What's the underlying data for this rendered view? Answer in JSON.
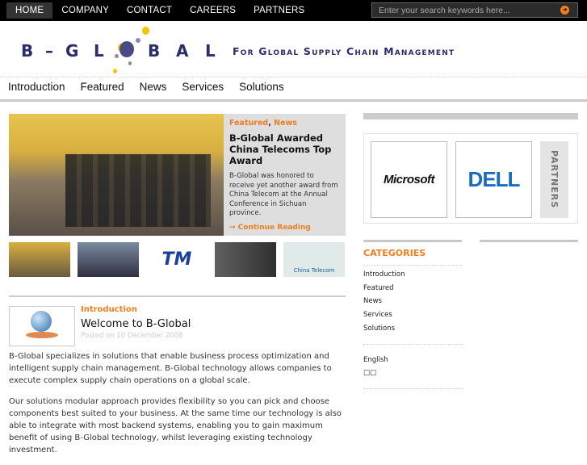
{
  "topnav": {
    "items": [
      "HOME",
      "COMPANY",
      "CONTACT",
      "CAREERS",
      "PARTNERS"
    ],
    "search_placeholder": "Enter your search keywords here..."
  },
  "logo": {
    "letters": [
      "B",
      "–",
      "G",
      "L",
      "B",
      "A",
      "L"
    ],
    "tagline": "For Global Supply Chain Management"
  },
  "mainnav": [
    "Introduction",
    "Featured",
    "News",
    "Services",
    "Solutions"
  ],
  "featured": {
    "cat1": "Featured",
    "sep": ",",
    "cat2": "News",
    "title": "B-Global Awarded China Telecoms Top Award",
    "excerpt": "B-Global was honored to receive yet another award from China Telecom at the Annual Conference in Sichuan province.",
    "more": "→ Continue Reading"
  },
  "thumbs": [
    "award-photo",
    "group-photo",
    "TM",
    "office-photo",
    "China Telecom"
  ],
  "post": {
    "category": "Introduction",
    "title": "Welcome to B-Global",
    "date": "Posted on 10 December 2008",
    "p1": "B-Global specializes in solutions that enable business process optimization and intelligent supply chain management. B-Global technology allows companies to execute complex supply chain operations on a global scale.",
    "p2": "Our solutions modular approach provides flexibility so you can pick and choose components best suited to your business. At the same time our technology is also able to integrate with most backend systems, enabling you to gain maximum benefit of using B-Global technology, whilst leveraging existing technology investment."
  },
  "partners": {
    "tab": "PARTNERS",
    "logos": [
      "Microsoft",
      "DELL"
    ]
  },
  "sidebar": {
    "categories_title": "CATEGORIES",
    "categories": [
      "Introduction",
      "Featured",
      "News",
      "Services",
      "Solutions"
    ],
    "languages": [
      "English",
      "□□"
    ]
  }
}
